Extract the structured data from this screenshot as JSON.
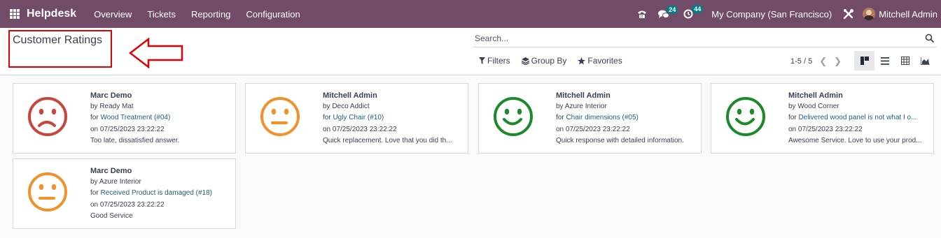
{
  "navbar": {
    "app_name": "Helpdesk",
    "menu": [
      "Overview",
      "Tickets",
      "Reporting",
      "Configuration"
    ],
    "messages_count": "24",
    "activities_count": "44",
    "company": "My Company (San Francisco)",
    "user": "Mitchell Admin",
    "bg_color": "#714b67"
  },
  "control_panel": {
    "title": "Customer Ratings",
    "search_placeholder": "Search...",
    "filters_label": "Filters",
    "group_by_label": "Group By",
    "favorites_label": "Favorites",
    "pager": "1-5 / 5"
  },
  "ratings": [
    {
      "name": "Marc Demo",
      "by": "by Ready Mat",
      "for_prefix": "for ",
      "ticket": "Wood Treatment (#04)",
      "date": "on 07/25/2023 23:22:22",
      "feedback": "Too late, dissatisfied answer.",
      "mood": "dissatisfied",
      "color": "#c9443a"
    },
    {
      "name": "Mitchell Admin",
      "by": "by Deco Addict",
      "for_prefix": "for ",
      "ticket": "Ugly Chair (#10)",
      "date": "on 07/25/2023 23:22:22",
      "feedback": "Quick replacement. Love that you did th...",
      "mood": "okay",
      "color": "#f0912b"
    },
    {
      "name": "Mitchell Admin",
      "by": "by Azure Interior",
      "for_prefix": "for ",
      "ticket": "Chair dimensions (#05)",
      "date": "on 07/25/2023 23:22:22",
      "feedback": "Quick response with detailed information.",
      "mood": "satisfied",
      "color": "#1a8a2a"
    },
    {
      "name": "Mitchell Admin",
      "by": "by Wood Corner",
      "for_prefix": "for ",
      "ticket": "Delivered wood panel is not what I o...",
      "date": "on 07/25/2023 23:22:22",
      "feedback": "Awesome Service. Love to use your prod...",
      "mood": "satisfied",
      "color": "#1a8a2a"
    },
    {
      "name": "Marc Demo",
      "by": "by Azure Interior",
      "for_prefix": "for ",
      "ticket": "Received Product is damaged (#18)",
      "date": "on 07/25/2023 23:22:22",
      "feedback": "Good Service",
      "mood": "okay",
      "color": "#f0912b"
    }
  ],
  "annotation_color": "#e00000"
}
